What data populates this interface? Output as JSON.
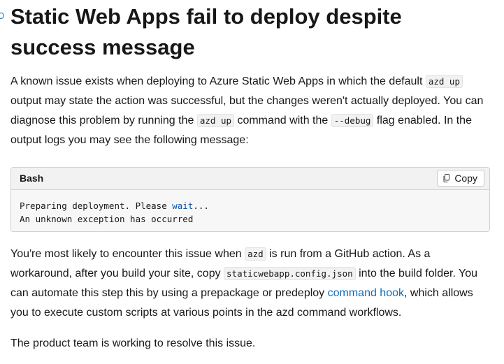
{
  "heading": "Static Web Apps fail to deploy despite success message",
  "intro": {
    "t1": "A known issue exists when deploying to Azure Static Web Apps in which the default ",
    "c1": "azd up",
    "t2": " output may state the action was successful, but the changes weren't actually deployed. You can diagnose this problem by running the ",
    "c2": "azd up",
    "t3": " command with the ",
    "c3": "--debug",
    "t4": " flag enabled. In the output logs you may see the following message:"
  },
  "code_block": {
    "language": "Bash",
    "copy_label": "Copy",
    "line1_a": "Preparing deployment. Please ",
    "line1_kw": "wait",
    "line1_b": "...",
    "line2": "An unknown exception has occurred"
  },
  "workaround": {
    "t1": "You're most likely to encounter this issue when ",
    "c1": "azd",
    "t2": " is run from a GitHub action. As a workaround, after you build your site, copy ",
    "c2": "staticwebapp.config.json",
    "t3": " into the build folder. You can automate this step this by using a prepackage or predeploy ",
    "link": "command hook",
    "t4": ", which allows you to execute custom scripts at various points in the azd command workflows."
  },
  "closing": "The product team is working to resolve this issue.",
  "colors": {
    "link": "#0f6cbd",
    "text": "#171717",
    "code_keyword": "#0451a5"
  }
}
